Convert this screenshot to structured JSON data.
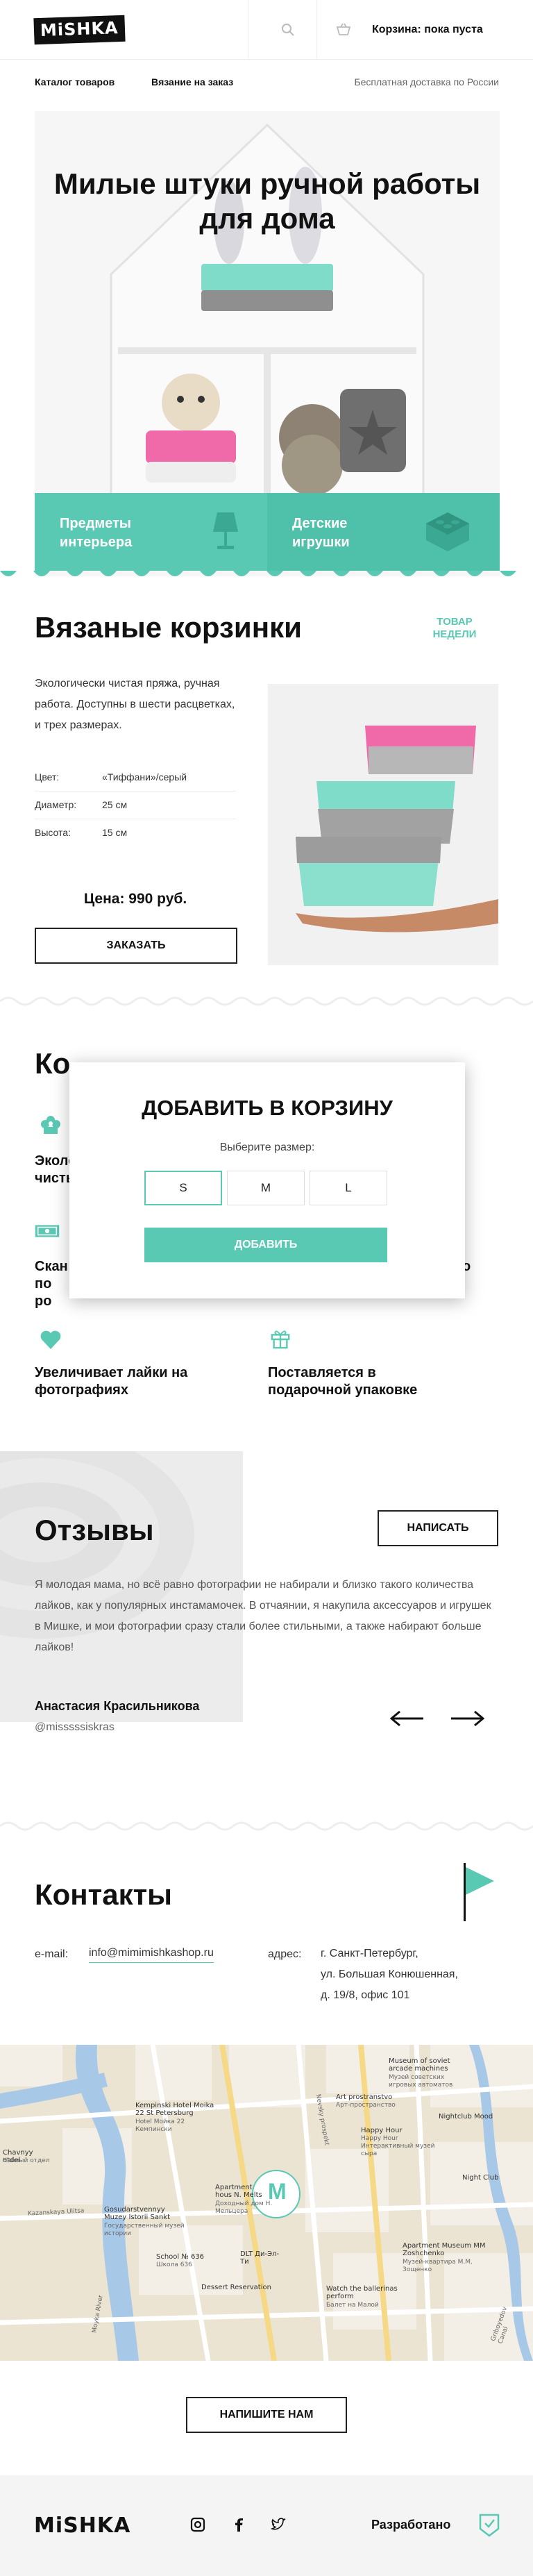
{
  "header": {
    "logo": "MiSHKA",
    "search_icon": "search-icon",
    "cart_icon": "cart-icon",
    "cart_label": "Корзина: пока пуста"
  },
  "nav": {
    "items": [
      "Каталог товаров",
      "Вязание на заказ"
    ],
    "delivery": "Бесплатная доставка по России"
  },
  "hero": {
    "title": "Милые штуки ручной работы для дома",
    "tiles": [
      {
        "label": "Предметы интерьера",
        "icon": "lamp-icon"
      },
      {
        "label": "Детские игрушки",
        "icon": "lego-icon"
      }
    ]
  },
  "product": {
    "title": "Вязаные корзинки",
    "badge": "ТОВАР НЕДЕЛИ",
    "description": "Экологически чистая пряжа, ручная работа. Доступны в шести расцветках, и трех размерах.",
    "specs": [
      {
        "label": "Цвет:",
        "value": "«Тиффани»/серый"
      },
      {
        "label": "Диаметр:",
        "value": "25 см"
      },
      {
        "label": "Высота:",
        "value": "15 см"
      }
    ],
    "price": "Цена: 990 руб.",
    "order_button": "ЗАКАЗАТЬ"
  },
  "benefits": {
    "title_visible": "Ко",
    "items": [
      {
        "label": "Эколо чисты",
        "icon": "flower-icon"
      },
      {
        "label": "Скан по ро",
        "icon": "money-icon"
      },
      {
        "label": "о",
        "icon": ""
      },
      {
        "label": "Увеличивает лайки на фотографиях",
        "icon": "heart-icon"
      },
      {
        "label": "Поставляется в подарочной упаковке",
        "icon": "gift-icon"
      }
    ]
  },
  "modal": {
    "title": "ДОБАВИТЬ В КОРЗИНУ",
    "subtitle": "Выберите размер:",
    "sizes": [
      "S",
      "M",
      "L"
    ],
    "selected_size": "S",
    "add_button": "ДОБАВИТЬ"
  },
  "reviews": {
    "title": "Отзывы",
    "write_button": "НАПИСАТЬ",
    "text": "Я молодая мама, но всё равно фотографии не набирали и близко такого количества лайков, как у популярных инстамамочек. В отчаянии, я накупила аксессуаров и игрушек в Мишке, и мои фотографии сразу стали более стильными, а также набирают больше лайков!",
    "author": "Анастасия Красильникова",
    "handle": "@misssssiskras",
    "prev_icon": "arrow-left-icon",
    "next_icon": "arrow-right-icon"
  },
  "contacts": {
    "title": "Контакты",
    "email_label": "e-mail:",
    "email": "info@mimimishkashop.ru",
    "address_label": "адрес:",
    "address_lines": [
      "г. Санкт-Петербург,",
      "ул. Большая Конюшенная,",
      "д. 19/8, офис 101"
    ],
    "flag_icon": "flag-icon",
    "write_us_button": "НАПИШИТЕ НАМ"
  },
  "map": {
    "pin_letter": "M",
    "labels": {
      "museum_soviet": "Museum of soviet arcade machines",
      "museum_soviet_ru": "Музей советских игровых автоматов",
      "art_prostranstvo": "Art prostranstvo",
      "art_prostranstvo_ru": "Арт-пространство",
      "happy_hour": "Happy Hour",
      "happy_hour_ru": "Happy Hour Интерактивный музей сыра",
      "nightclub": "Nightclub Mood",
      "night_club": "Night Club",
      "kempinski": "Kempinski Hotel Moika 22 St Petersburg",
      "kempinski_ru": "Hotel Мойка 22 Кемпински",
      "apartment": "Apartment hous N. Melts",
      "apartment_ru": "Доходный дом Н. Мельцера",
      "state_museum": "Gosudarstvennyy Muzey Istorii Sankt",
      "state_museum_ru": "Государственный музей истории",
      "school": "School № 636",
      "school_ru": "Школа 636",
      "dlt": "DLT Ди-Эл-Ти",
      "dessert": "Dessert Reservation",
      "zoshchenko": "Apartment Museum MM Zoshchenko",
      "zoshchenko_ru": "Музей-квартира М.М. Зощенко",
      "ballet": "Watch the ballerinas perform",
      "ballet_ru": "Балет на Малой",
      "ravelin": "Chavnyy otdel",
      "ravelin_ru": "Чайный отдел",
      "moyka": "Moyka River",
      "griboedov": "Griboyedov Canal",
      "nevsky": "Nevsky prospekt",
      "kazanskaya": "Kazanskaya Ulitsa"
    }
  },
  "footer": {
    "logo": "MiSHKA",
    "social_icons": [
      "instagram-icon",
      "facebook-icon",
      "twitter-icon"
    ],
    "developed_by": "Разработано",
    "dev_logo_icon": "htmlacademy-icon"
  },
  "colors": {
    "accent": "#59c9b3",
    "text": "#111111",
    "muted": "#666666",
    "footer_bg": "#f4f4f4"
  }
}
